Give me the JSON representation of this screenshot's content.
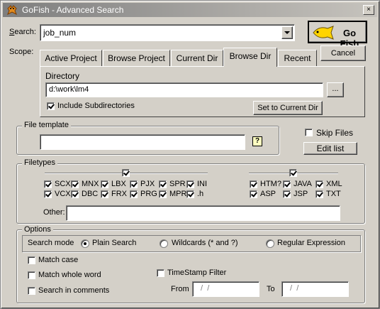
{
  "window": {
    "title": "GoFish - Advanced Search",
    "close_glyph": "×"
  },
  "search": {
    "label": "Search:",
    "value": "job_num"
  },
  "go_button": {
    "label": "Go Fish"
  },
  "scope": {
    "label": "Scope:",
    "tabs": [
      "Active Project",
      "Browse Project",
      "Current Dir",
      "Browse Dir",
      "Recent"
    ],
    "active_tab": "Browse Dir",
    "cancel_label": "Cancel",
    "directory_label": "Directory",
    "directory_value": "d:\\work\\lm4",
    "browse_label": "...",
    "include_subdirs_label": "Include Subdirectories",
    "include_subdirs_checked": true,
    "set_current_label": "Set to Current Dir"
  },
  "file_template": {
    "label": "File template",
    "value": "",
    "help_glyph": "?"
  },
  "skip_files": {
    "label": "Skip Files",
    "checked": false
  },
  "edit_list": {
    "label": "Edit list"
  },
  "filetypes": {
    "label": "Filetypes",
    "group1": [
      {
        "label": "SCX",
        "checked": true
      },
      {
        "label": "MNX",
        "checked": true
      },
      {
        "label": "LBX",
        "checked": true
      },
      {
        "label": "PJX",
        "checked": true
      },
      {
        "label": "SPR",
        "checked": true
      },
      {
        "label": "INI",
        "checked": true
      },
      {
        "label": "VCX",
        "checked": true
      },
      {
        "label": "DBC",
        "checked": true
      },
      {
        "label": "FRX",
        "checked": true
      },
      {
        "label": "PRG",
        "checked": true
      },
      {
        "label": "MPR",
        "checked": true
      },
      {
        "label": ".h",
        "checked": true
      }
    ],
    "group2": [
      {
        "label": "HTM?",
        "checked": true
      },
      {
        "label": "JAVA",
        "checked": true
      },
      {
        "label": "XML",
        "checked": true
      },
      {
        "label": "ASP",
        "checked": true
      },
      {
        "label": "JSP",
        "checked": true
      },
      {
        "label": "TXT",
        "checked": true
      }
    ],
    "other_label": "Other:",
    "other_value": ""
  },
  "options": {
    "label": "Options",
    "search_mode_label": "Search mode",
    "modes": [
      "Plain Search",
      "Wildcards (* and ?)",
      "Regular Expression"
    ],
    "selected_mode": "Plain Search",
    "match_case": "Match case",
    "match_whole_word": "Match whole word",
    "search_in_comments": "Search in comments",
    "timestamp_filter": "TimeStamp Filter",
    "from_label": "From",
    "from_value": " /  /",
    "to_label": "To",
    "to_value": " /  /"
  }
}
